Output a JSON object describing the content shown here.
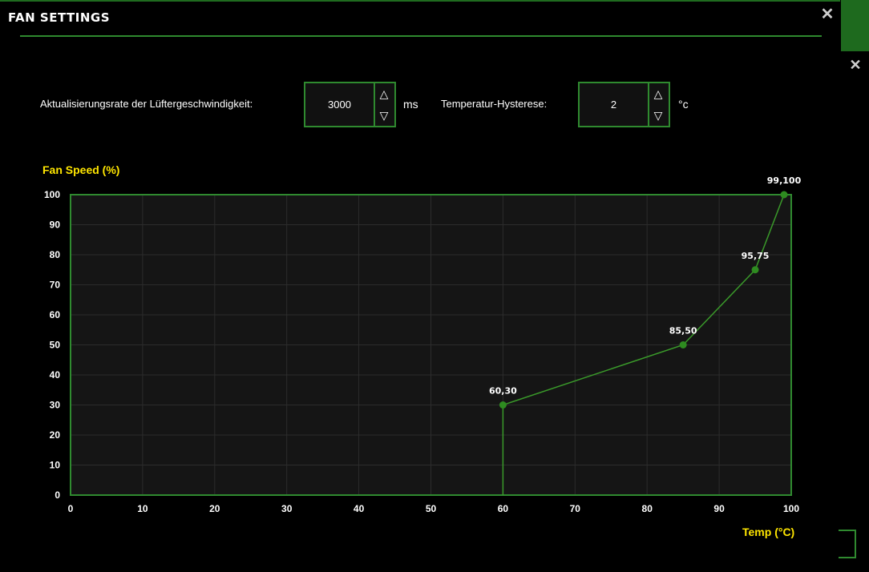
{
  "window": {
    "title": "FAN SETTINGS"
  },
  "refresh": {
    "label": "Aktualisierungsrate der Lüftergeschwindigkeit:",
    "value": "3000",
    "unit": "ms"
  },
  "hysteresis": {
    "label": "Temperatur-Hysterese:",
    "value": "2",
    "unit": "°c"
  },
  "icons": {
    "close": "close-icon",
    "up": "arrow-up-icon",
    "down": "arrow-down-icon"
  },
  "colors": {
    "accent": "#2f8a2f",
    "line": "#3a9a2a",
    "point": "#2e8b20",
    "axis_title": "#ffe600",
    "plot_bg": "#151515",
    "grid": "#2c2c2c"
  },
  "chart_data": {
    "type": "line",
    "ylabel": "Fan Speed (%)",
    "xlabel": "Temp (°C)",
    "xlim": [
      0,
      100
    ],
    "ylim": [
      0,
      100
    ],
    "xticks": [
      0,
      10,
      20,
      30,
      40,
      50,
      60,
      70,
      80,
      90,
      100
    ],
    "yticks": [
      0,
      10,
      20,
      30,
      40,
      50,
      60,
      70,
      80,
      90,
      100
    ],
    "grid": true,
    "series": [
      {
        "points": [
          {
            "x": 60,
            "y": 0
          },
          {
            "x": 60,
            "y": 30,
            "label": "60,30"
          },
          {
            "x": 85,
            "y": 50,
            "label": "85,50"
          },
          {
            "x": 95,
            "y": 75,
            "label": "95,75"
          },
          {
            "x": 99,
            "y": 100,
            "label": "99,100"
          }
        ]
      }
    ]
  }
}
